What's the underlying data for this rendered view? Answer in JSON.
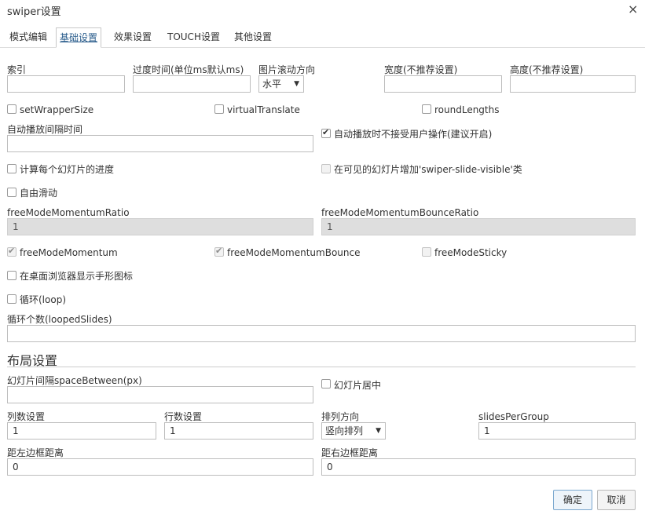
{
  "window": {
    "title": "swiper设置",
    "close_glyph": "×"
  },
  "tabs": [
    {
      "label": "模式编辑",
      "active": false
    },
    {
      "label": "基础设置",
      "active": true
    },
    {
      "label": "效果设置",
      "active": false
    },
    {
      "label": "TOUCH设置",
      "active": false
    },
    {
      "label": "其他设置",
      "active": false
    }
  ],
  "basic": {
    "index_label": "索引",
    "index_value": "",
    "transition_label": "过度时间(单位ms默认ms)",
    "transition_value": "",
    "direction_label": "图片滚动方向",
    "direction_value": "水平",
    "width_label": "宽度(不推荐设置)",
    "width_value": "",
    "height_label": "高度(不推荐设置)",
    "height_value": "",
    "setWrapperSize": {
      "label": "setWrapperSize",
      "checked": false
    },
    "virtualTranslate": {
      "label": "virtualTranslate",
      "checked": false
    },
    "roundLengths": {
      "label": "roundLengths",
      "checked": false
    },
    "autoplay_label": "自动播放间隔时间",
    "autoplay_value": "",
    "autoplay_disable": {
      "label": "自动播放时不接受用户操作(建议开启)",
      "checked": true
    },
    "watch_progress": {
      "label": "计算每个幻灯片的进度",
      "checked": false
    },
    "slide_visible": {
      "label": "在可见的幻灯片增加'swiper-slide-visible'类",
      "checked": false
    },
    "free_mode": {
      "label": "自由滑动",
      "checked": false
    },
    "momentum_ratio_label": "freeModeMomentumRatio",
    "momentum_ratio_value": "1",
    "bounce_ratio_label": "freeModeMomentumBounceRatio",
    "bounce_ratio_value": "1",
    "free_momentum": {
      "label": "freeModeMomentum",
      "checked": true
    },
    "free_bounce": {
      "label": "freeModeMomentumBounce",
      "checked": true
    },
    "free_sticky": {
      "label": "freeModeSticky",
      "checked": false
    },
    "grab_cursor": {
      "label": "在桌面浏览器显示手形图标",
      "checked": false
    },
    "loop": {
      "label": "循环(loop)",
      "checked": false
    },
    "looped_slides_label": "循环个数(loopedSlides)",
    "looped_slides_value": ""
  },
  "layout": {
    "section_title": "布局设置",
    "space_between_label": "幻灯片间隔spaceBetween(px)",
    "space_between_value": "",
    "centered": {
      "label": "幻灯片居中",
      "checked": false
    },
    "columns_label": "列数设置",
    "columns_value": "1",
    "rows_label": "行数设置",
    "rows_value": "1",
    "fill_label": "排列方向",
    "fill_value": "竖向排列",
    "per_group_label": "slidesPerGroup",
    "per_group_value": "1",
    "offset_before_label": "距左边框距离",
    "offset_before_value": "0",
    "offset_after_label": "距右边框距离",
    "offset_after_value": "0"
  },
  "footer": {
    "ok_label": "确定",
    "cancel_label": "取消"
  }
}
